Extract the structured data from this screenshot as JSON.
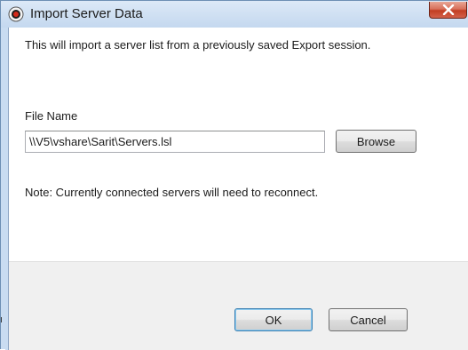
{
  "window": {
    "title": "Import Server Data"
  },
  "body": {
    "intro": "This will import a server list from a previously saved Export session.",
    "file_label": "File Name",
    "file_value": "\\\\V5\\vshare\\Sarit\\Servers.lsl",
    "browse_label": "Browse",
    "note": "Note: Currently connected servers will need to reconnect."
  },
  "footer": {
    "ok_label": "OK",
    "cancel_label": "Cancel"
  },
  "icons": {
    "app": "record-icon",
    "close": "close-icon"
  },
  "colors": {
    "title_bar": "#c9dcf1",
    "close_button": "#c74a30",
    "footer": "#f0f0f0",
    "default_button_border": "#3c7fb1"
  }
}
